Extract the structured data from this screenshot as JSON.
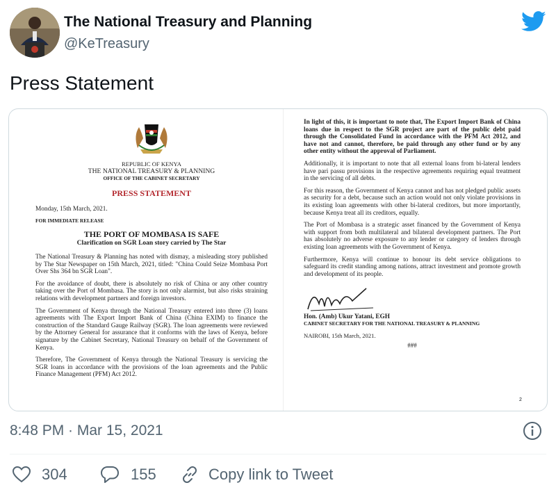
{
  "account": {
    "name": "The National Treasury and Planning",
    "handle": "@KeTreasury"
  },
  "tweet_text": "Press Statement",
  "document": {
    "header": {
      "republic": "REPUBLIC OF KENYA",
      "ministry": "THE NATIONAL TREASURY & PLANNING",
      "office": "OFFICE OF THE CABINET SECRETARY"
    },
    "press_label": "PRESS STATEMENT",
    "date": "Monday, 15th March, 2021.",
    "release": "FOR IMMEDIATE RELEASE",
    "title": "THE PORT OF MOMBASA IS SAFE",
    "subtitle": "Clarification on SGR Loan story carried by The Star",
    "paragraphs_left": [
      "The National Treasury & Planning has noted with dismay, a misleading story published by The Star Newspaper on 15th March, 2021, titled: \"China Could Seize Mombasa Port Over Shs 364 bn SGR Loan\".",
      "For the avoidance of doubt, there is absolutely no risk of China or any other country taking over the Port of Mombasa. The story is not only alarmist, but also risks straining relations with development partners and foreign investors.",
      "The Government of Kenya through the National Treasury entered into three (3) loans agreements with The Export Import Bank of China (China EXIM) to finance the construction of the Standard Gauge Railway (SGR). The loan agreements were reviewed by the Attorney General for assurance that it conforms with the laws of Kenya, before signature by the Cabinet Secretary, National Treasury on behalf of the Government of Kenya.",
      "Therefore, The Government of Kenya through the National Treasury is servicing the SGR loans in accordance with the provisions of the loan agreements and the Public Finance Management (PFM) Act 2012."
    ],
    "paragraphs_right": [
      "In light of this, it is important to note that, The Export Import Bank of China loans due in respect to the SGR project are part of the public debt paid through the Consolidated Fund in accordance with the PFM Act 2012, and have not and cannot, therefore, be paid through any other fund or by any other entity without the approval of Parliament.",
      "Additionally, it is important to note that all external loans from bi-lateral lenders have pari passu provisions in the respective agreements requiring equal treatment in the servicing of all debts.",
      "For this reason, the Government of Kenya cannot and has not pledged public assets as security for a debt, because such an action would not only violate provisions in its existing loan agreements with other bi-lateral creditors, but more importantly, because Kenya treat all its creditors, equally.",
      "The Port of Mombasa is a strategic asset financed by the Government of Kenya with support from both multilateral and bilateral development partners. The Port has absolutely no adverse exposure to any lender or category of lenders through existing loan agreements with the Government of Kenya.",
      "Furthermore, Kenya will continue to honour its debt service obligations to safeguard its credit standing among nations, attract investment and promote growth and development of its people."
    ],
    "signatory_name": "Hon. (Amb) Ukur Yatani, EGH",
    "signatory_role": "CABINET SECRETARY FOR THE NATIONAL TREASURY & PLANNING",
    "signed_place_date": "NAIROBI, 15th March, 2021.",
    "end_mark": "###",
    "page_number": "2"
  },
  "timestamp": "8:48 PM · Mar 15, 2021",
  "actions": {
    "likes": "304",
    "replies": "155",
    "copy_link": "Copy link to Tweet"
  },
  "colors": {
    "twitter_blue": "#1d9bf0",
    "press_red": "#b3282e",
    "muted_text": "#536471"
  }
}
